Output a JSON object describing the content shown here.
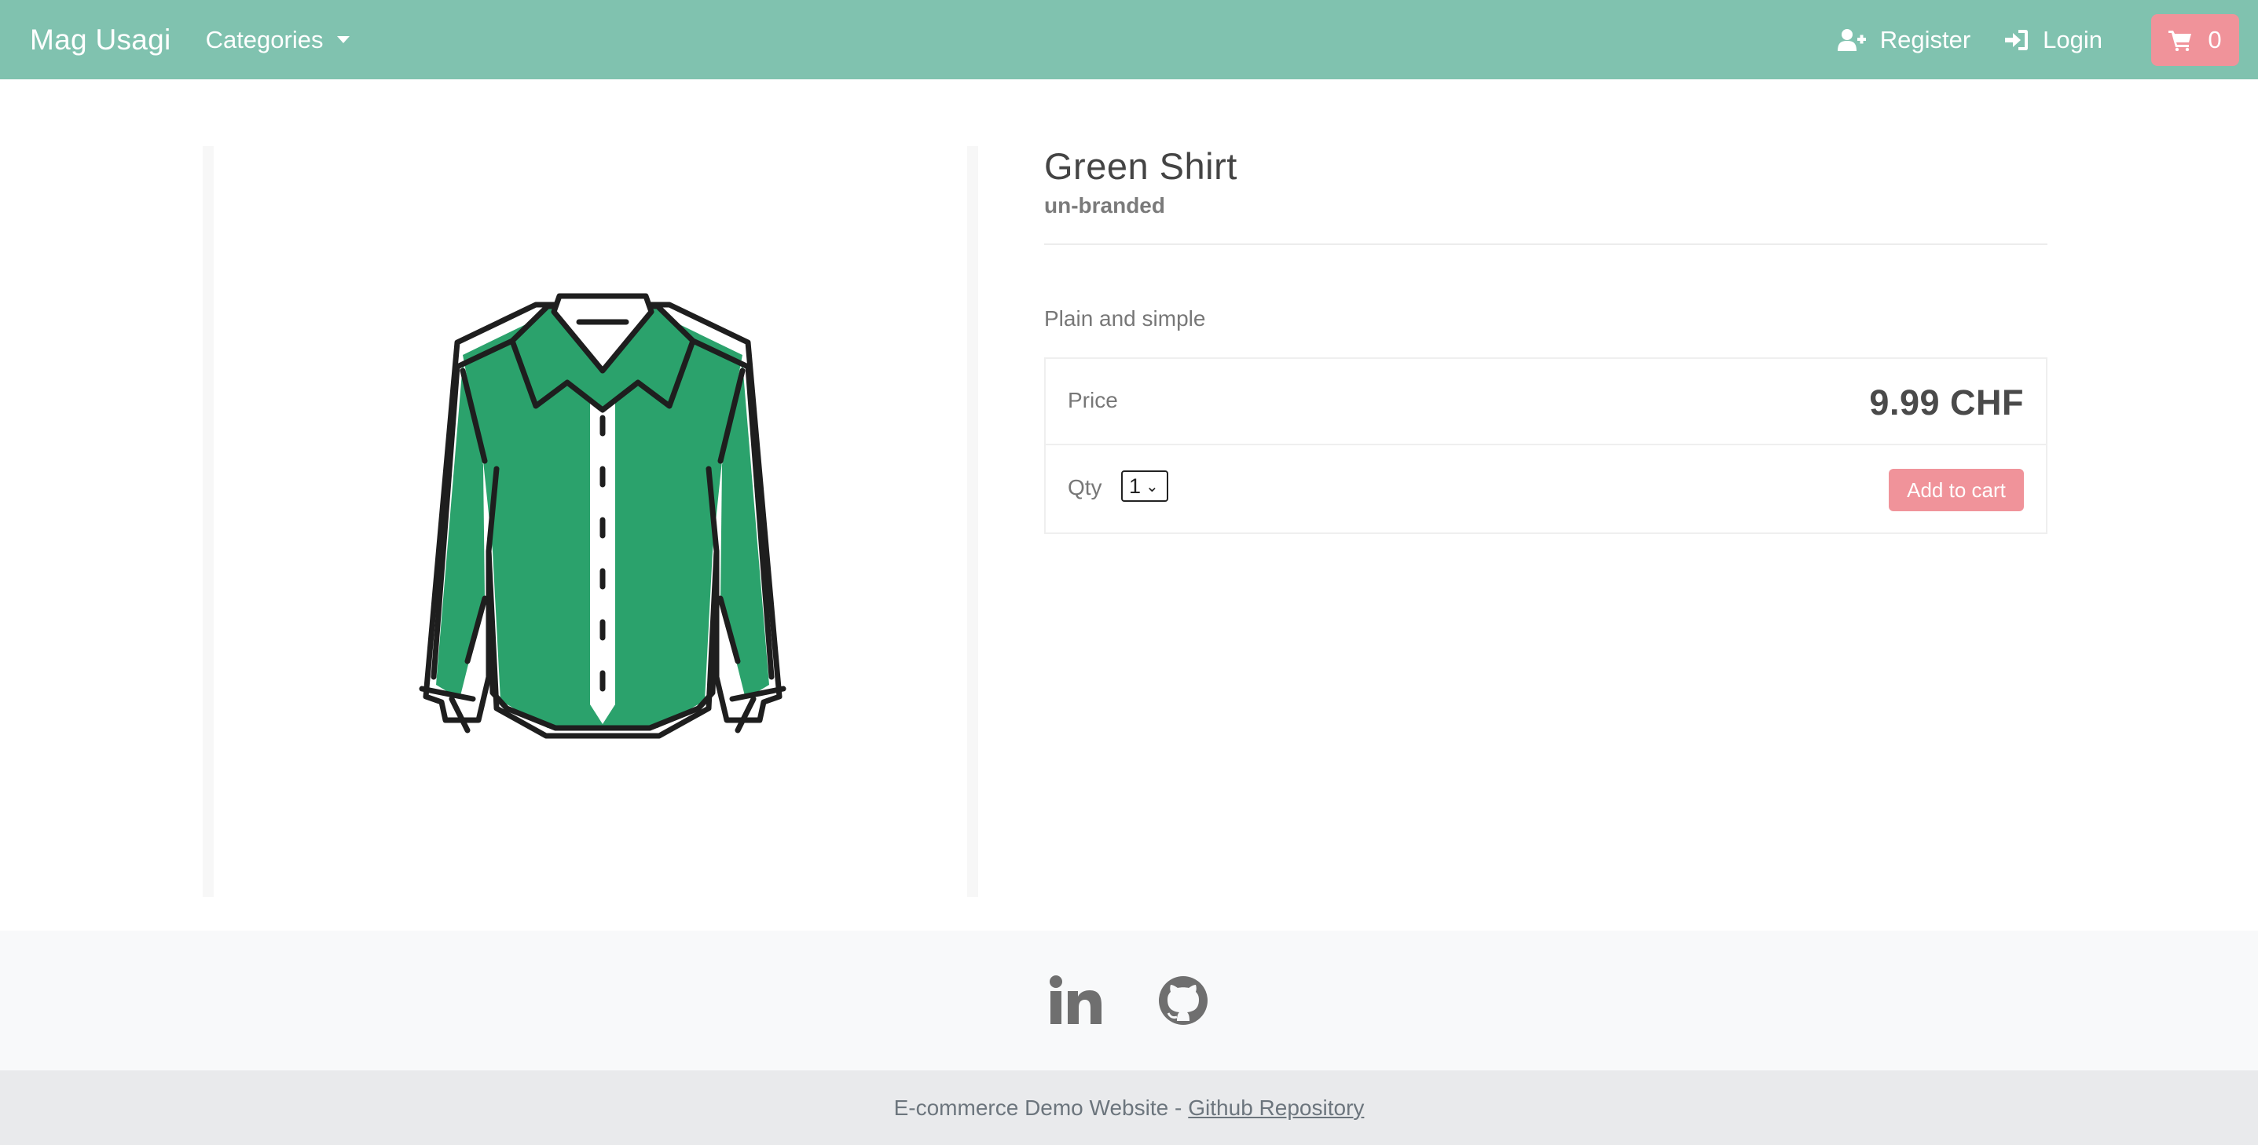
{
  "navbar": {
    "brand": "Mag Usagi",
    "categories_label": "Categories",
    "register_label": "Register",
    "login_label": "Login",
    "cart_count": "0",
    "background_color": "#80c2af",
    "cart_color": "#f0939a"
  },
  "product": {
    "title": "Green Shirt",
    "brand": "un-branded",
    "description": "Plain and simple",
    "price_label": "Price",
    "price": "9.99 CHF",
    "qty_label": "Qty",
    "qty_value": "1",
    "add_to_cart_label": "Add to cart",
    "image_icon": "green-shirt-icon"
  },
  "footer": {
    "social_icons": [
      "linkedin-icon",
      "github-icon"
    ],
    "text": "E-commerce Demo Website -",
    "link_label": "Github Repository"
  }
}
